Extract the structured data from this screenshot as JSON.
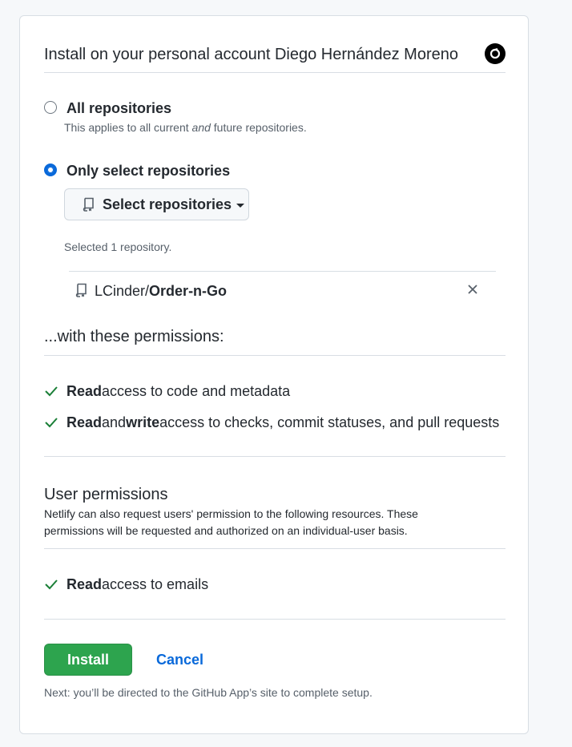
{
  "install": {
    "title": "Install on your personal account Diego Hernández Moreno",
    "avatar_icon": "user-avatar-icon"
  },
  "repo_access": {
    "all": {
      "label": "All repositories",
      "note_prefix": "This applies to all current ",
      "note_em": "and",
      "note_suffix": " future repositories.",
      "checked": false
    },
    "select": {
      "label": "Only select repositories",
      "checked": true,
      "button_label": "Select repositories",
      "selected_count_text": "Selected 1 repository.",
      "repos": [
        {
          "owner": "LCinder/",
          "name": "Order-n-Go"
        }
      ]
    }
  },
  "permissions": {
    "heading": "...with these permissions:",
    "items": [
      {
        "parts": [
          {
            "b": "Read"
          },
          {
            "t": " access to code and metadata"
          }
        ]
      },
      {
        "parts": [
          {
            "b": "Read"
          },
          {
            "t": " and "
          },
          {
            "b": "write"
          },
          {
            "t": " access to checks, commit statuses, and pull requests"
          }
        ]
      }
    ]
  },
  "user_permissions": {
    "heading": "User permissions",
    "description_line1": "Netlify can also request users' permission to the following resources. These",
    "description_line2": "permissions will be requested and authorized on an individual-user basis.",
    "items": [
      {
        "parts": [
          {
            "b": "Read"
          },
          {
            "t": " access to emails"
          }
        ]
      }
    ]
  },
  "actions": {
    "install_label": "Install",
    "cancel_label": "Cancel",
    "footer_note": "Next: you’ll be directed to the GitHub App’s site to complete setup."
  },
  "colors": {
    "accent": "#0969da",
    "success": "#2da44e",
    "check": "#1a7f37"
  }
}
